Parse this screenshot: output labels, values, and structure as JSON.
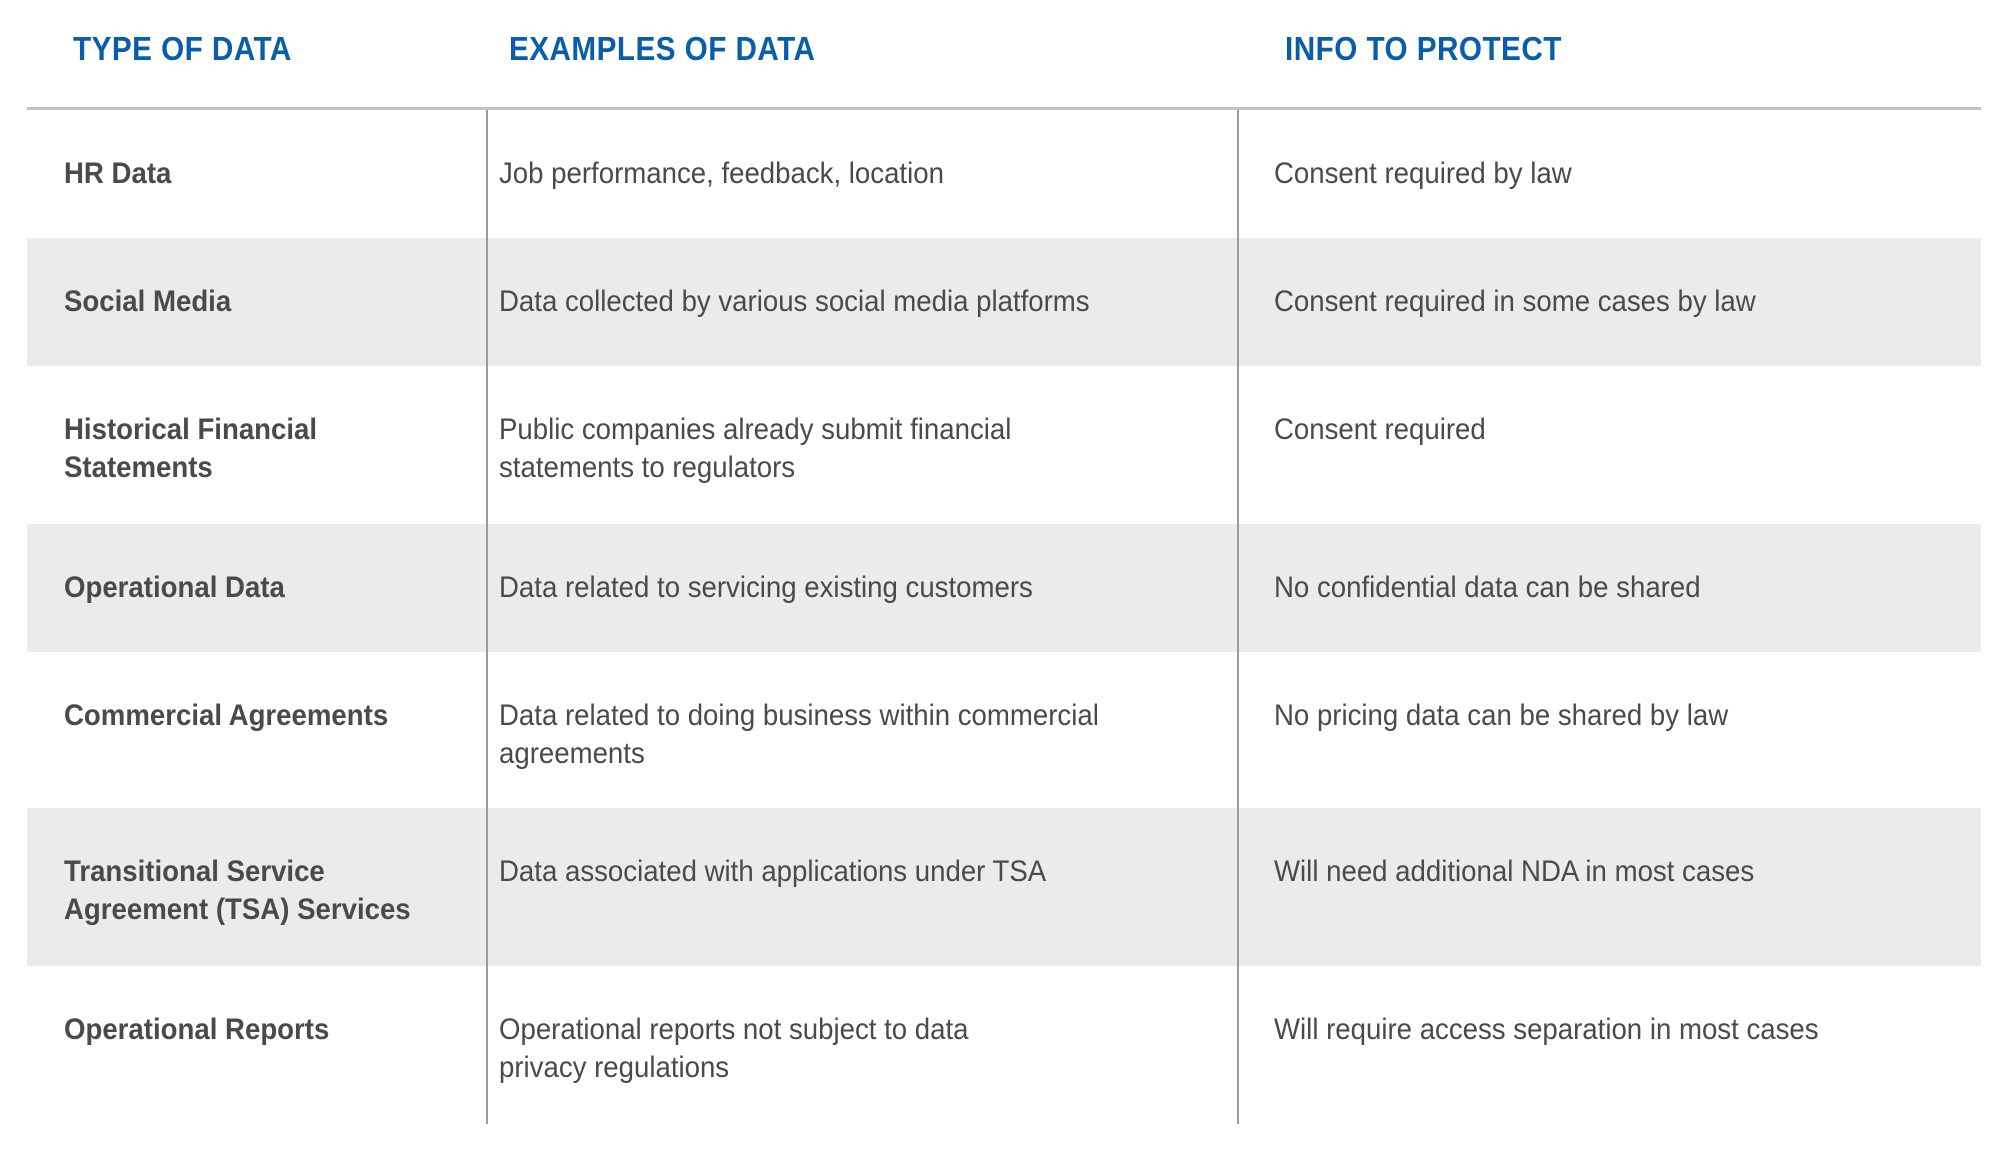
{
  "colors": {
    "header_text": "#0a5ea8",
    "body_text": "#4a4a4a",
    "shaded_row": "#ebebeb",
    "rule": "#c4c4c4",
    "divider": "#9a9a9a"
  },
  "table": {
    "headers": [
      "TYPE OF DATA",
      "EXAMPLES OF DATA",
      "INFO TO PROTECT"
    ],
    "rows": [
      {
        "type": "HR Data",
        "examples": "Job performance, feedback, location",
        "protect": "Consent required by law",
        "shaded": false
      },
      {
        "type": "Social Media",
        "examples": "Data collected by various social media platforms",
        "protect": "Consent required in some cases by law",
        "shaded": true
      },
      {
        "type": "Historical Financial\nStatements",
        "examples": "Public companies already submit financial\nstatements to regulators",
        "protect": "Consent required",
        "shaded": false
      },
      {
        "type": "Operational Data",
        "examples": "Data related to servicing existing customers",
        "protect": "No confidential data can be shared",
        "shaded": true
      },
      {
        "type": "Commercial Agreements",
        "examples": "Data related to doing business within commercial\nagreements",
        "protect": "No pricing data can be shared by law",
        "shaded": false
      },
      {
        "type": "Transitional Service\nAgreement (TSA) Services",
        "examples": "Data associated with applications under TSA",
        "protect": "Will need additional NDA in most cases",
        "shaded": true
      },
      {
        "type": "Operational Reports",
        "examples": "Operational reports not subject to data\nprivacy regulations",
        "protect": "Will require access separation in most cases",
        "shaded": false
      }
    ]
  }
}
